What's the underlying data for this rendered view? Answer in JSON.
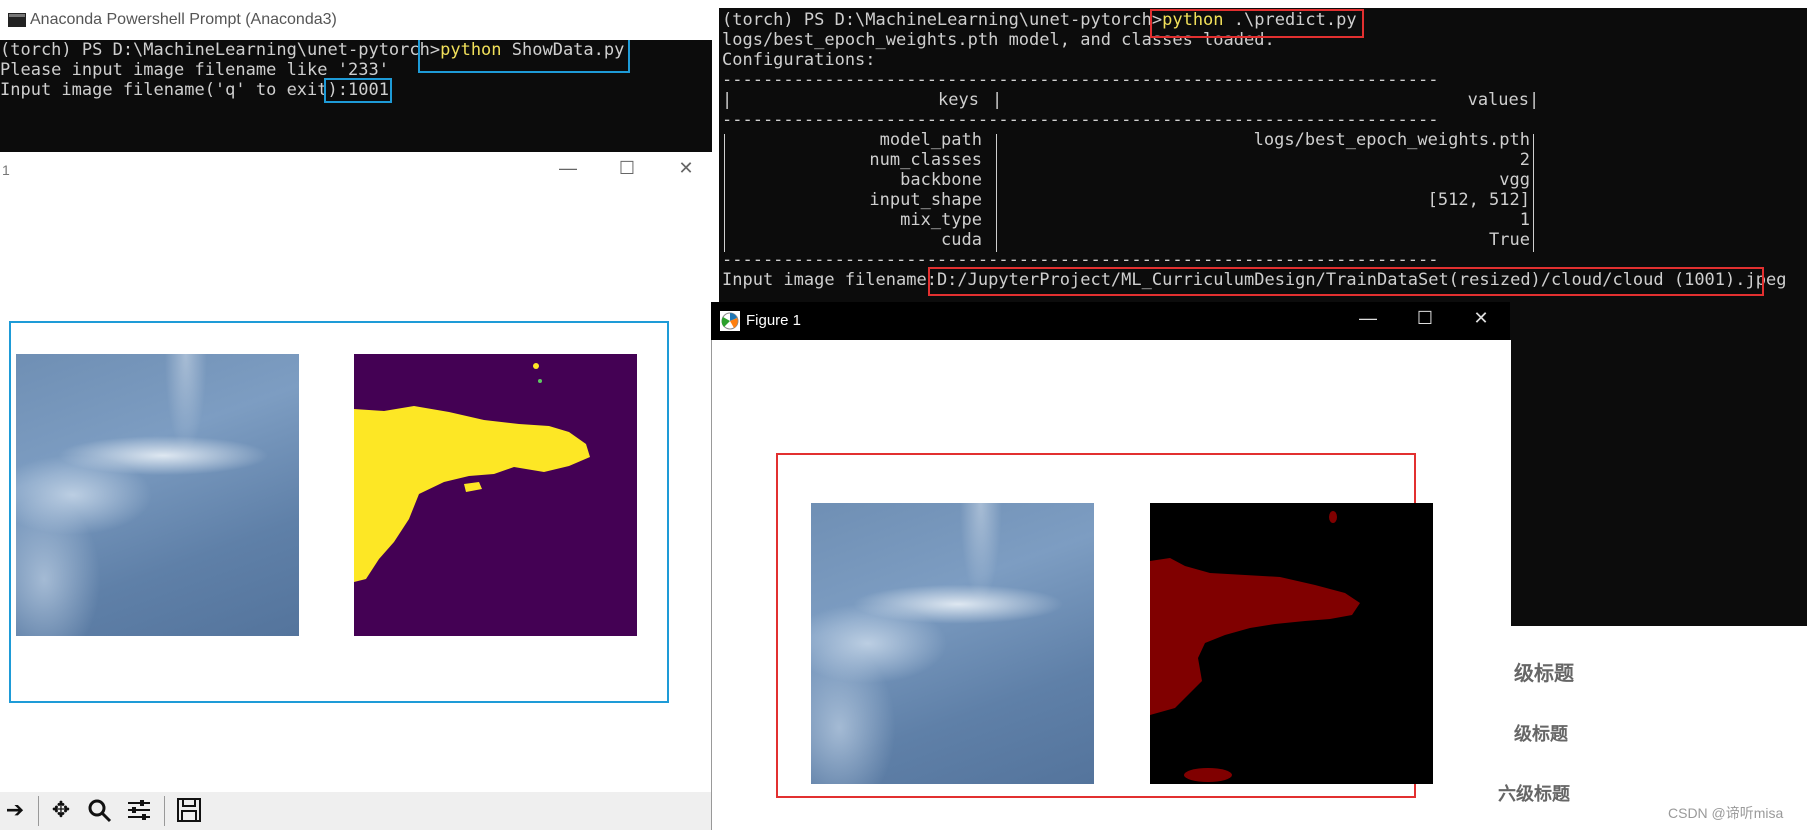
{
  "left_terminal": {
    "title": "Anaconda Powershell Prompt (Anaconda3)",
    "prompt": "(torch) PS D:\\MachineLearning\\unet-pytorch>",
    "cmd_keyword": "python",
    "cmd_arg": " ShowData.py",
    "line2": "Please input image filename like '233'",
    "line3_label": "Input image filename('q' to exit)",
    "line3_value": ":1001"
  },
  "left_window": {
    "title": "1",
    "minimize": "—",
    "maximize": "☐",
    "close": "✕"
  },
  "right_terminal": {
    "prompt": "(torch) PS D:\\MachineLearning\\unet-pytorch>",
    "cmd_keyword": "python",
    "cmd_arg": " .\\predict.py",
    "loaded": "logs/best_epoch_weights.pth model, and classes loaded.",
    "config_label": "Configurations:",
    "divider": "----------------------------------------------------------------------",
    "head_keys": "keys",
    "head_values": "values",
    "rows": [
      {
        "key": "model_path",
        "value": "logs/best_epoch_weights.pth"
      },
      {
        "key": "num_classes",
        "value": "2"
      },
      {
        "key": "backbone",
        "value": "vgg"
      },
      {
        "key": "input_shape",
        "value": "[512, 512]"
      },
      {
        "key": "mix_type",
        "value": "1"
      },
      {
        "key": "cuda",
        "value": "True"
      }
    ],
    "input_label": "Input image filename:",
    "input_value": "D:/JupyterProject/ML_CurriculumDesign/TrainDataSet(resized)/cloud/cloud (1001).jpeg"
  },
  "right_window": {
    "title": "Figure 1",
    "minimize": "—",
    "maximize": "☐",
    "close": "✕"
  },
  "toolbar": {
    "icons": [
      "arrow-right-icon",
      "move-icon",
      "zoom-icon",
      "configure-icon",
      "save-icon"
    ]
  },
  "sidebar_headings": {
    "h1": "级标题",
    "h2": "级标题",
    "h3": "六级标题"
  },
  "watermark": "CSDN @谛听misa",
  "colors": {
    "terminal_bg": "#0c0c0c",
    "highlight_yellow": "#f1e05a",
    "mask_yellow": "#fde725",
    "mask_purple": "#440154",
    "pred_red": "#800000",
    "box_red": "#e23030",
    "box_blue": "#1e9bd7"
  }
}
